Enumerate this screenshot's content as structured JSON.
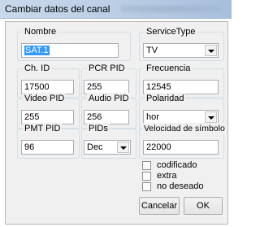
{
  "window": {
    "title": "Cambiar datos del canal"
  },
  "fields": {
    "nombre": {
      "label": "Nombre",
      "value": "SAT.1"
    },
    "service_type": {
      "label": "ServiceType",
      "value": "TV"
    },
    "ch_id": {
      "label": "Ch. ID",
      "value": "17500"
    },
    "pcr_pid": {
      "label": "PCR PID",
      "value": "255"
    },
    "frecuencia": {
      "label": "Frecuencia",
      "value": "12545"
    },
    "video_pid": {
      "label": "Video PID",
      "value": "255"
    },
    "audio_pid": {
      "label": "Audio PID",
      "value": "256"
    },
    "polaridad": {
      "label": "Polaridad",
      "value": "hor"
    },
    "pmt_pid": {
      "label": "PMT PID",
      "value": "96"
    },
    "pids": {
      "label": "PIDs",
      "value": "Dec"
    },
    "velocidad": {
      "label": "Velocidad de símbolo",
      "value": "22000"
    }
  },
  "checkboxes": {
    "codificado": {
      "label": "codificado",
      "checked": false
    },
    "extra": {
      "label": "extra",
      "checked": false
    },
    "no_deseado": {
      "label": "no deseado",
      "checked": false
    }
  },
  "buttons": {
    "cancel": "Cancelar",
    "ok": "OK"
  },
  "icons": {
    "dropdown": "chevron-down-icon"
  }
}
